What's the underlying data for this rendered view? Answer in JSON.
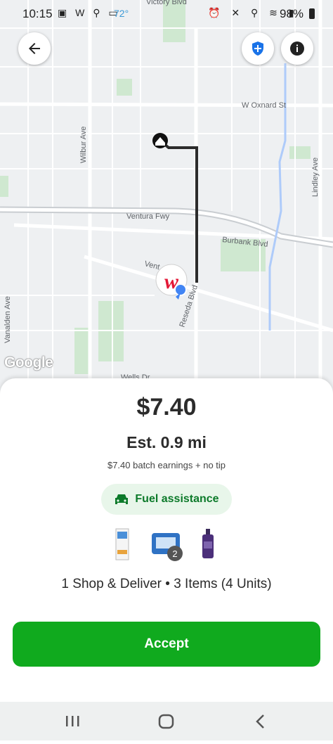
{
  "status_bar": {
    "time": "10:15",
    "temperature": "72°",
    "battery": "98%"
  },
  "map": {
    "labels": {
      "victory": "Victory Blvd",
      "oxnard": "W Oxnard St",
      "wilbur": "Wilbur Ave",
      "lindley": "Lindley Ave",
      "ventura_fwy": "Ventura Fwy",
      "burbank": "Burbank Blvd",
      "ventura_blvd": "Vent",
      "reseda": "Reseda Blvd",
      "vanalden": "Vanalden Ave",
      "wells": "Wells Dr"
    },
    "google_logo": "Google"
  },
  "offer": {
    "price": "$7.40",
    "distance": "Est. 0.9 mi",
    "earnings_note": "$7.40 batch earnings + no tip",
    "fuel_label": "Fuel assistance",
    "item_badge": "2",
    "summary": "1 Shop & Deliver • 3 Items (4 Units)",
    "accept_label": "Accept"
  },
  "colors": {
    "accent_green": "#10aa1e",
    "fuel_bg": "#e8f6ea",
    "shield_blue": "#1a73e8"
  }
}
